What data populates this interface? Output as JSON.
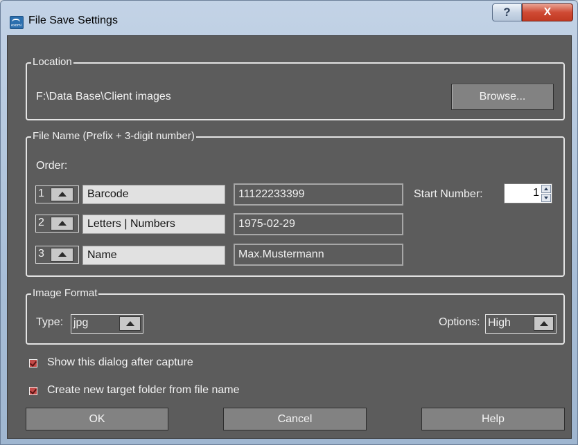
{
  "window": {
    "title": "File Save Settings",
    "help_glyph": "?",
    "close_glyph": "X",
    "app_icon_text": "exomi"
  },
  "location": {
    "group_label": "Location",
    "path": "F:\\Data Base\\Client images",
    "browse_label": "Browse..."
  },
  "file_name": {
    "group_label": "File Name (Prefix + 3-digit number)",
    "order_label": "Order:",
    "rows": [
      {
        "num": "1",
        "type": "Barcode",
        "value": "11122233399"
      },
      {
        "num": "2",
        "type": "Letters | Numbers",
        "value": "1975-02-29"
      },
      {
        "num": "3",
        "type": "Name",
        "value": "Max.Mustermann"
      }
    ],
    "start_number_label": "Start Number:",
    "start_number": "1"
  },
  "image_format": {
    "group_label": "Image Format",
    "type_label": "Type:",
    "type_value": "jpg",
    "options_label": "Options:",
    "options_value": "High"
  },
  "checkboxes": {
    "show_dialog": {
      "label": "Show this dialog after capture",
      "checked": true
    },
    "create_folder": {
      "label": "Create new target folder from file name",
      "checked": true
    }
  },
  "buttons": {
    "ok": "OK",
    "cancel": "Cancel",
    "help": "Help"
  },
  "colors": {
    "dialog_bg": "#5c5c5c",
    "button_bg": "#828282",
    "close_red": "#c8412a",
    "checkbox_red": "#c44a48"
  }
}
